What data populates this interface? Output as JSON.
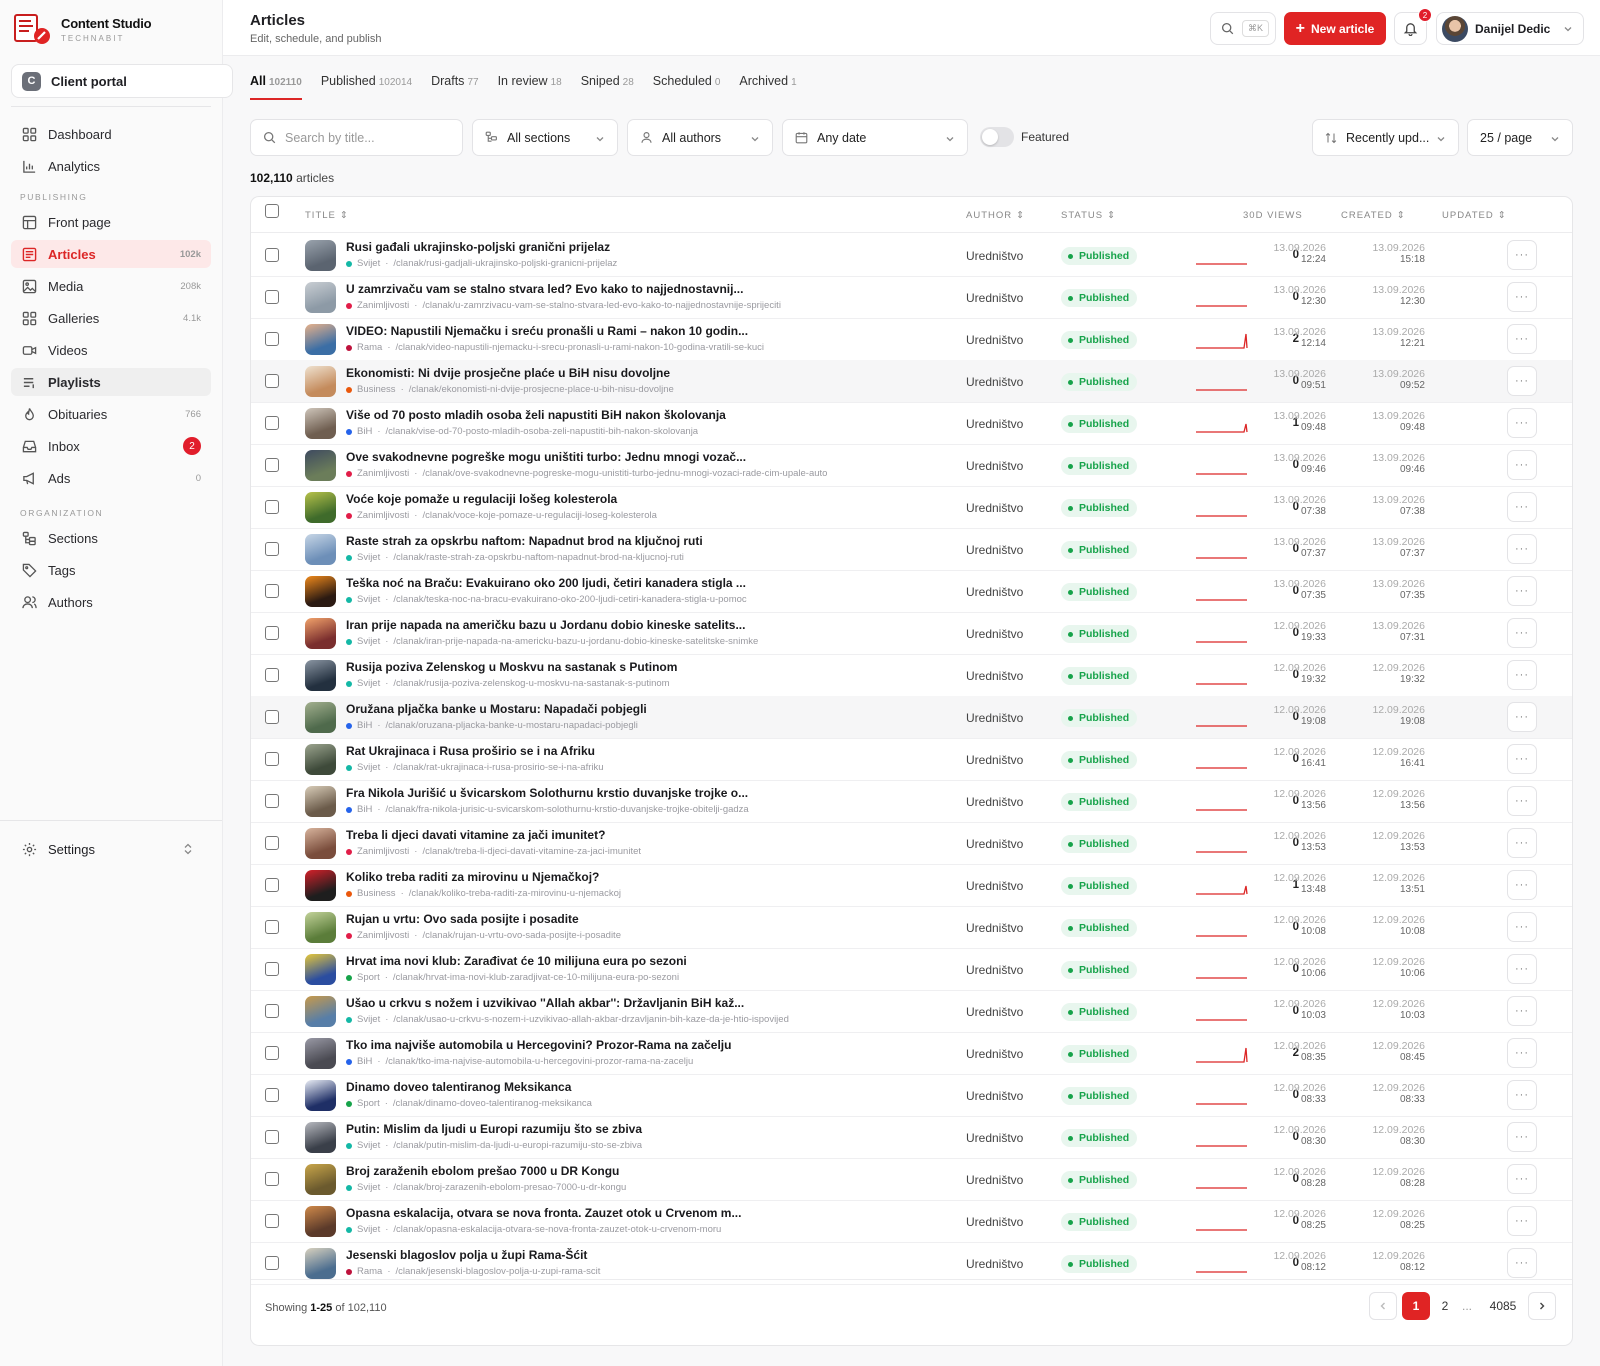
{
  "app": {
    "name": "Content Studio",
    "sub": "TECHNABIT"
  },
  "portal": {
    "letter": "C",
    "label": "Client portal"
  },
  "nav": [
    {
      "key": "dashboard",
      "label": "Dashboard",
      "count": ""
    },
    {
      "key": "analytics",
      "label": "Analytics",
      "count": ""
    },
    {
      "key": "front-page",
      "label": "Front page",
      "count": ""
    },
    {
      "key": "articles",
      "label": "Articles",
      "count": "102k"
    },
    {
      "key": "media",
      "label": "Media",
      "count": "208k"
    },
    {
      "key": "galleries",
      "label": "Galleries",
      "count": "4.1k"
    },
    {
      "key": "videos",
      "label": "Videos",
      "count": ""
    },
    {
      "key": "playlists",
      "label": "Playlists",
      "count": ""
    },
    {
      "key": "obituaries",
      "label": "Obituaries",
      "count": "766"
    },
    {
      "key": "inbox",
      "label": "Inbox",
      "count": "2"
    },
    {
      "key": "ads",
      "label": "Ads",
      "count": "0"
    },
    {
      "key": "sections",
      "label": "Sections",
      "count": ""
    },
    {
      "key": "tags",
      "label": "Tags",
      "count": ""
    },
    {
      "key": "authors",
      "label": "Authors",
      "count": ""
    }
  ],
  "nav_sections": {
    "publishing": "PUBLISHING",
    "organization": "ORGANIZATION"
  },
  "settings_label": "Settings",
  "header": {
    "title": "Articles",
    "subtitle": "Edit, schedule, and publish",
    "kbd": "⌘K",
    "new_article": "New article",
    "notif_count": "2",
    "user": "Danijel Dedic"
  },
  "tabs": [
    {
      "label": "All",
      "count": "102110"
    },
    {
      "label": "Published",
      "count": "102014"
    },
    {
      "label": "Drafts",
      "count": "77"
    },
    {
      "label": "In review",
      "count": "18"
    },
    {
      "label": "Sniped",
      "count": "28"
    },
    {
      "label": "Scheduled",
      "count": "0"
    },
    {
      "label": "Archived",
      "count": "1"
    }
  ],
  "filters": {
    "search_placeholder": "Search by title...",
    "sections": "All sections",
    "authors": "All authors",
    "date": "Any date",
    "featured": "Featured",
    "sort": "Recently upd...",
    "per_page": "25 / page"
  },
  "count_line": {
    "num": "102,110",
    "word": "articles"
  },
  "columns": {
    "title": "TITLE",
    "author": "AUTHOR",
    "status": "STATUS",
    "views": "30D VIEWS",
    "created": "CREATED",
    "updated": "UPDATED"
  },
  "colors": {
    "accent": "#e02424",
    "svijet": "#14b8a6",
    "zanimljivosti": "#e11d48",
    "rama": "#be123c",
    "business": "#ea580c",
    "bih": "#2563eb",
    "sport": "#16a34a"
  },
  "rows": [
    {
      "title": "Rusi gađali ukrajinsko-poljski granični prijelaz",
      "section": "Svijet",
      "path": "/clanak/rusi-gadjali-ukrajinsko-poljski-granicni-prijelaz",
      "author": "Uredništvo",
      "status": "Published",
      "views": "0",
      "created_d": "13.09.2026",
      "created_t": "12:24",
      "updated_d": "13.09.2026",
      "updated_t": "15:18"
    },
    {
      "title": "U zamrzivaču vam se stalno stvara led? Evo kako to najjednostavnij...",
      "section": "Zanimljivosti",
      "path": "/clanak/u-zamrzivacu-vam-se-stalno-stvara-led-evo-kako-to-najjednostavnije-sprijeciti",
      "author": "Uredništvo",
      "status": "Published",
      "views": "0",
      "created_d": "13.09.2026",
      "created_t": "12:30",
      "updated_d": "13.09.2026",
      "updated_t": "12:30"
    },
    {
      "title": "VIDEO: Napustili Njemačku i sreću pronašli u Rami – nakon 10 godin...",
      "section": "Rama",
      "path": "/clanak/video-napustili-njemacku-i-srecu-pronasli-u-rami-nakon-10-godina-vratili-se-kuci",
      "author": "Uredništvo",
      "status": "Published",
      "views": "2",
      "created_d": "13.09.2026",
      "created_t": "12:14",
      "updated_d": "13.09.2026",
      "updated_t": "12:21"
    },
    {
      "title": "Ekonomisti: Ni dvije prosječne plaće u BiH nisu dovoljne",
      "section": "Business",
      "path": "/clanak/ekonomisti-ni-dvije-prosjecne-place-u-bih-nisu-dovoljne",
      "author": "Uredništvo",
      "status": "Published",
      "views": "0",
      "created_d": "13.09.2026",
      "created_t": "09:51",
      "updated_d": "13.09.2026",
      "updated_t": "09:52"
    },
    {
      "title": "Više od 70 posto mladih osoba želi napustiti BiH nakon školovanja",
      "section": "BiH",
      "path": "/clanak/vise-od-70-posto-mladih-osoba-zeli-napustiti-bih-nakon-skolovanja",
      "author": "Uredništvo",
      "status": "Published",
      "views": "1",
      "created_d": "13.09.2026",
      "created_t": "09:48",
      "updated_d": "13.09.2026",
      "updated_t": "09:48"
    },
    {
      "title": "Ove svakodnevne pogreške mogu uništiti turbo: Jednu mnogi vozač...",
      "section": "Zanimljivosti",
      "path": "/clanak/ove-svakodnevne-pogreske-mogu-unistiti-turbo-jednu-mnogi-vozaci-rade-cim-upale-auto",
      "author": "Uredništvo",
      "status": "Published",
      "views": "0",
      "created_d": "13.09.2026",
      "created_t": "09:46",
      "updated_d": "13.09.2026",
      "updated_t": "09:46"
    },
    {
      "title": "Voće koje pomaže u regulaciji lošeg kolesterola",
      "section": "Zanimljivosti",
      "path": "/clanak/voce-koje-pomaze-u-regulaciji-loseg-kolesterola",
      "author": "Uredništvo",
      "status": "Published",
      "views": "0",
      "created_d": "13.09.2026",
      "created_t": "07:38",
      "updated_d": "13.09.2026",
      "updated_t": "07:38"
    },
    {
      "title": "Raste strah za opskrbu naftom: Napadnut brod na ključnoj ruti",
      "section": "Svijet",
      "path": "/clanak/raste-strah-za-opskrbu-naftom-napadnut-brod-na-kljucnoj-ruti",
      "author": "Uredništvo",
      "status": "Published",
      "views": "0",
      "created_d": "13.09.2026",
      "created_t": "07:37",
      "updated_d": "13.09.2026",
      "updated_t": "07:37"
    },
    {
      "title": "Teška noć na Braču: Evakuirano oko 200 ljudi, četiri kanadera stigla ...",
      "section": "Svijet",
      "path": "/clanak/teska-noc-na-bracu-evakuirano-oko-200-ljudi-cetiri-kanadera-stigla-u-pomoc",
      "author": "Uredništvo",
      "status": "Published",
      "views": "0",
      "created_d": "13.09.2026",
      "created_t": "07:35",
      "updated_d": "13.09.2026",
      "updated_t": "07:35"
    },
    {
      "title": "Iran prije napada na američku bazu u Jordanu dobio kineske satelits...",
      "section": "Svijet",
      "path": "/clanak/iran-prije-napada-na-americku-bazu-u-jordanu-dobio-kineske-satelitske-snimke",
      "author": "Uredništvo",
      "status": "Published",
      "views": "0",
      "created_d": "12.09.2026",
      "created_t": "19:33",
      "updated_d": "13.09.2026",
      "updated_t": "07:31"
    },
    {
      "title": "Rusija poziva Zelenskog u Moskvu na sastanak s Putinom",
      "section": "Svijet",
      "path": "/clanak/rusija-poziva-zelenskog-u-moskvu-na-sastanak-s-putinom",
      "author": "Uredništvo",
      "status": "Published",
      "views": "0",
      "created_d": "12.09.2026",
      "created_t": "19:32",
      "updated_d": "12.09.2026",
      "updated_t": "19:32"
    },
    {
      "title": "Oružana pljačka banke u Mostaru: Napadači pobjegli",
      "section": "BiH",
      "path": "/clanak/oruzana-pljacka-banke-u-mostaru-napadaci-pobjegli",
      "author": "Uredništvo",
      "status": "Published",
      "views": "0",
      "created_d": "12.09.2026",
      "created_t": "19:08",
      "updated_d": "12.09.2026",
      "updated_t": "19:08"
    },
    {
      "title": "Rat Ukrajinaca i Rusa proširio se i na Afriku",
      "section": "Svijet",
      "path": "/clanak/rat-ukrajinaca-i-rusa-prosirio-se-i-na-afriku",
      "author": "Uredništvo",
      "status": "Published",
      "views": "0",
      "created_d": "12.09.2026",
      "created_t": "16:41",
      "updated_d": "12.09.2026",
      "updated_t": "16:41"
    },
    {
      "title": "Fra Nikola Jurišić u švicarskom Solothurnu krstio duvanjske trojke o...",
      "section": "BiH",
      "path": "/clanak/fra-nikola-jurisic-u-svicarskom-solothurnu-krstio-duvanjske-trojke-obitelji-gadza",
      "author": "Uredništvo",
      "status": "Published",
      "views": "0",
      "created_d": "12.09.2026",
      "created_t": "13:56",
      "updated_d": "12.09.2026",
      "updated_t": "13:56"
    },
    {
      "title": "Treba li djeci davati vitamine za jači imunitet?",
      "section": "Zanimljivosti",
      "path": "/clanak/treba-li-djeci-davati-vitamine-za-jaci-imunitet",
      "author": "Uredništvo",
      "status": "Published",
      "views": "0",
      "created_d": "12.09.2026",
      "created_t": "13:53",
      "updated_d": "12.09.2026",
      "updated_t": "13:53"
    },
    {
      "title": "Koliko treba raditi za mirovinu u Njemačkoj?",
      "section": "Business",
      "path": "/clanak/koliko-treba-raditi-za-mirovinu-u-njemackoj",
      "author": "Uredništvo",
      "status": "Published",
      "views": "1",
      "created_d": "12.09.2026",
      "created_t": "13:48",
      "updated_d": "12.09.2026",
      "updated_t": "13:51"
    },
    {
      "title": "Rujan u vrtu: Ovo sada posijte i posadite",
      "section": "Zanimljivosti",
      "path": "/clanak/rujan-u-vrtu-ovo-sada-posijte-i-posadite",
      "author": "Uredništvo",
      "status": "Published",
      "views": "0",
      "created_d": "12.09.2026",
      "created_t": "10:08",
      "updated_d": "12.09.2026",
      "updated_t": "10:08"
    },
    {
      "title": "Hrvat ima novi klub: Zarađivat će 10 milijuna eura po sezoni",
      "section": "Sport",
      "path": "/clanak/hrvat-ima-novi-klub-zaradjivat-ce-10-milijuna-eura-po-sezoni",
      "author": "Uredništvo",
      "status": "Published",
      "views": "0",
      "created_d": "12.09.2026",
      "created_t": "10:06",
      "updated_d": "12.09.2026",
      "updated_t": "10:06"
    },
    {
      "title": "Ušao u crkvu s nožem i uzvikivao ''Allah akbar'': Državljanin BiH kaž...",
      "section": "Svijet",
      "path": "/clanak/usao-u-crkvu-s-nozem-i-uzvikivao-allah-akbar-drzavljanin-bih-kaze-da-je-htio-ispovijed",
      "author": "Uredništvo",
      "status": "Published",
      "views": "0",
      "created_d": "12.09.2026",
      "created_t": "10:03",
      "updated_d": "12.09.2026",
      "updated_t": "10:03"
    },
    {
      "title": "Tko ima najviše automobila u Hercegovini? Prozor-Rama na začelju",
      "section": "BiH",
      "path": "/clanak/tko-ima-najvise-automobila-u-hercegovini-prozor-rama-na-zacelju",
      "author": "Uredništvo",
      "status": "Published",
      "views": "2",
      "created_d": "12.09.2026",
      "created_t": "08:35",
      "updated_d": "12.09.2026",
      "updated_t": "08:45"
    },
    {
      "title": "Dinamo doveo talentiranog Meksikanca",
      "section": "Sport",
      "path": "/clanak/dinamo-doveo-talentiranog-meksikanca",
      "author": "Uredništvo",
      "status": "Published",
      "views": "0",
      "created_d": "12.09.2026",
      "created_t": "08:33",
      "updated_d": "12.09.2026",
      "updated_t": "08:33"
    },
    {
      "title": "Putin: Mislim da ljudi u Europi razumiju što se zbiva",
      "section": "Svijet",
      "path": "/clanak/putin-mislim-da-ljudi-u-europi-razumiju-sto-se-zbiva",
      "author": "Uredništvo",
      "status": "Published",
      "views": "0",
      "created_d": "12.09.2026",
      "created_t": "08:30",
      "updated_d": "12.09.2026",
      "updated_t": "08:30"
    },
    {
      "title": "Broj zaraženih ebolom prešao 7000 u DR Kongu",
      "section": "Svijet",
      "path": "/clanak/broj-zarazenih-ebolom-presao-7000-u-dr-kongu",
      "author": "Uredništvo",
      "status": "Published",
      "views": "0",
      "created_d": "12.09.2026",
      "created_t": "08:28",
      "updated_d": "12.09.2026",
      "updated_t": "08:28"
    },
    {
      "title": "Opasna eskalacija, otvara se nova fronta. Zauzet otok u Crvenom m...",
      "section": "Svijet",
      "path": "/clanak/opasna-eskalacija-otvara-se-nova-fronta-zauzet-otok-u-crvenom-moru",
      "author": "Uredništvo",
      "status": "Published",
      "views": "0",
      "created_d": "12.09.2026",
      "created_t": "08:25",
      "updated_d": "12.09.2026",
      "updated_t": "08:25"
    },
    {
      "title": "Jesenski blagoslov polja u župi Rama-Šćit",
      "section": "Rama",
      "path": "/clanak/jesenski-blagoslov-polja-u-zupi-rama-scit",
      "author": "Uredništvo",
      "status": "Published",
      "views": "0",
      "created_d": "12.09.2026",
      "created_t": "08:12",
      "updated_d": "12.09.2026",
      "updated_t": "08:12"
    }
  ],
  "footer": {
    "showing_prefix": "Showing",
    "range": "1-25",
    "of": "of",
    "total": "102,110"
  },
  "pagination": {
    "current": "1",
    "next": "2",
    "ellipsis": "...",
    "last": "4085"
  }
}
